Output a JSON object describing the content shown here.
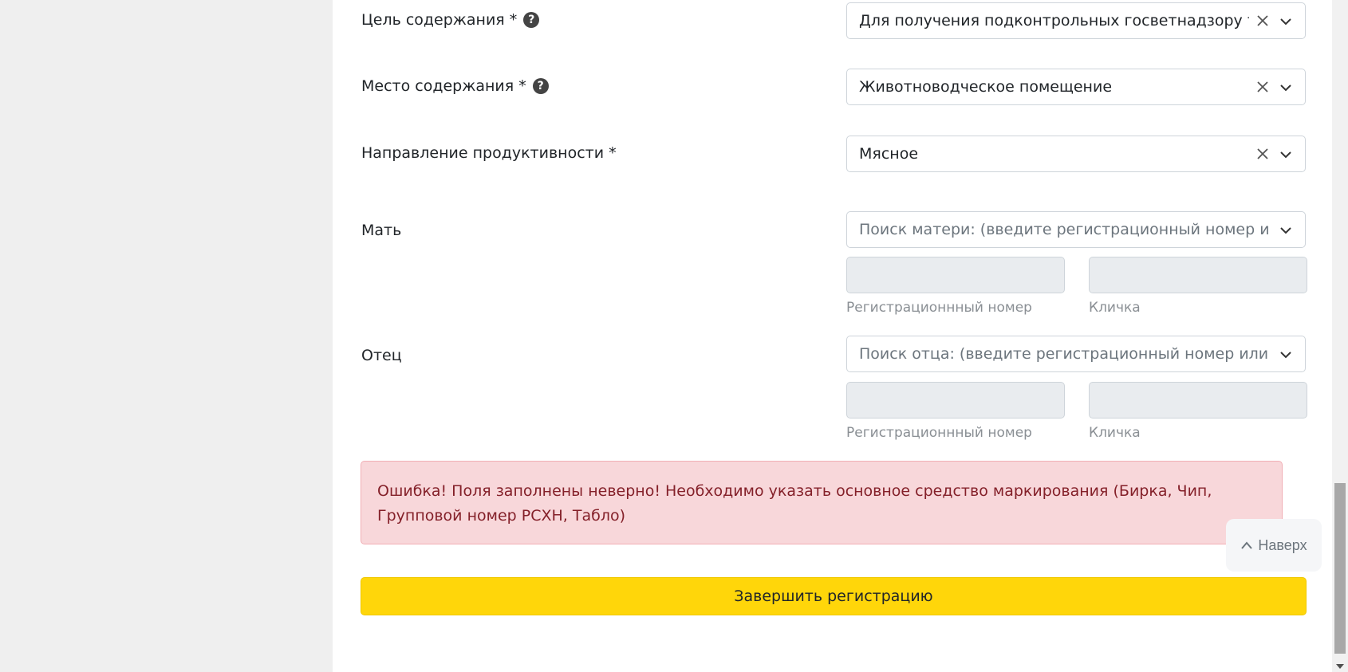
{
  "form": {
    "purpose": {
      "label": "Цель содержания *",
      "value": "Для получения подконтрольных госветнадзору товаров"
    },
    "place": {
      "label": "Место содержания *",
      "value": "Животноводческое помещение"
    },
    "direction": {
      "label": "Направление продуктивности *",
      "value": "Мясное"
    },
    "mother": {
      "label": "Мать",
      "placeholder": "Поиск матери: (введите регистрационный номер или кличку)",
      "reg_label": "Регистрационнный номер",
      "name_label": "Кличка"
    },
    "father": {
      "label": "Отец",
      "placeholder": "Поиск отца: (введите регистрационный номер или кличку)",
      "reg_label": "Регистрационнный номер",
      "name_label": "Кличка"
    }
  },
  "help_glyph": "?",
  "alert": {
    "text": "Ошибка! Поля заполнены неверно! Необходимо указать основное средство маркирования (Бирка, Чип, Групповой номер РСХН, Табло)"
  },
  "submit_label": "Завершить регистрацию",
  "to_top_label": "Наверх",
  "icons": {
    "clear": "close-icon",
    "dropdown": "chevron-down-icon",
    "help": "help-icon",
    "to_top": "chevron-up-icon"
  },
  "colors": {
    "submit_bg": "#ffd60a",
    "alert_bg": "#f8d7da",
    "alert_text": "#842029"
  }
}
